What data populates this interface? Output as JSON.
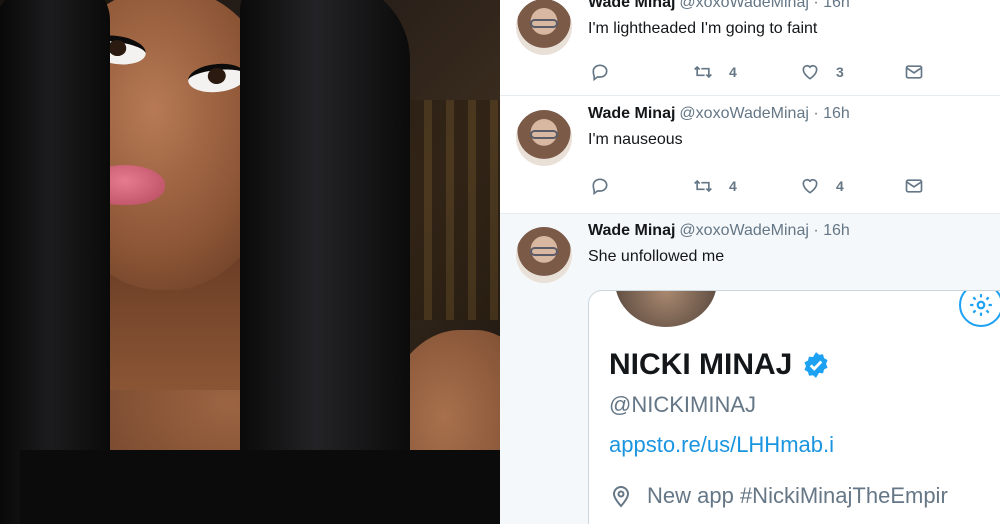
{
  "tweets": [
    {
      "name": "Wade Minaj",
      "handle": "@xoxoWadeMinaj · 16h",
      "text": "I'm lightheaded I'm going to faint",
      "retweets": "4",
      "likes": "3"
    },
    {
      "name": "Wade Minaj",
      "handle": "@xoxoWadeMinaj · 16h",
      "text": "I'm nauseous",
      "retweets": "4",
      "likes": "4"
    },
    {
      "name": "Wade Minaj",
      "handle": "@xoxoWadeMinaj · 16h",
      "text": "She unfollowed me"
    }
  ],
  "profile_card": {
    "name": "NICKI MINAJ",
    "handle": "@NICKIMINAJ",
    "link": "appsto.re/us/LHHmab.i",
    "location": "New app #NickiMinajTheEmpir"
  },
  "colors": {
    "accent": "#1da1f2",
    "link": "#1b95e0",
    "muted": "#657786",
    "text": "#14171a"
  },
  "icons": [
    "reply-icon",
    "retweet-icon",
    "like-icon",
    "message-icon",
    "settings-gear-icon",
    "verified-badge-icon",
    "location-pin-icon"
  ]
}
